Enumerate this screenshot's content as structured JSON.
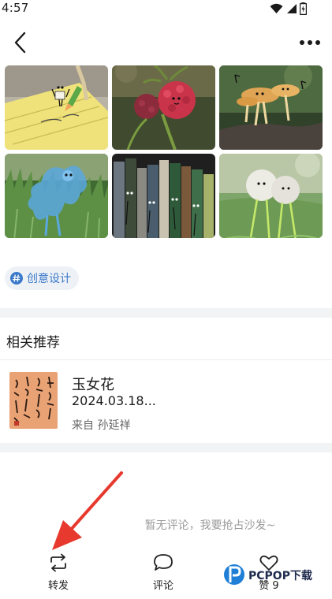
{
  "status_bar": {
    "time": "4:57",
    "icons": [
      "wifi-icon",
      "signal-icon",
      "battery-icon"
    ]
  },
  "header": {
    "back_icon": "back-arrow-icon",
    "more_icon": "more-dots-icon"
  },
  "gallery": {
    "photos": [
      "sticky-note-character-photo",
      "raspberry-character-photo",
      "mushroom-character-photo",
      "grass-blob-character-photo",
      "bookshelf-character-photo",
      "dandelion-character-photo"
    ]
  },
  "tag": {
    "icon": "hashtag-icon",
    "label": "创意设计"
  },
  "related": {
    "title": "相关推荐",
    "item": {
      "title": "玉女花",
      "date": "2024.03.18...",
      "author": "来自 孙延祥"
    }
  },
  "comments": {
    "empty_text": "暂无评论，我要抢占沙发~"
  },
  "bottom_bar": {
    "repost_label": "转发",
    "comment_label": "评论",
    "like_label": "赞 9"
  },
  "watermark": {
    "text": "PCPOP下载"
  },
  "colors": {
    "accent": "#3a78c9",
    "tag_bg": "#eef2f7",
    "band": "#f2f3f5",
    "arrow": "#e8392e"
  }
}
